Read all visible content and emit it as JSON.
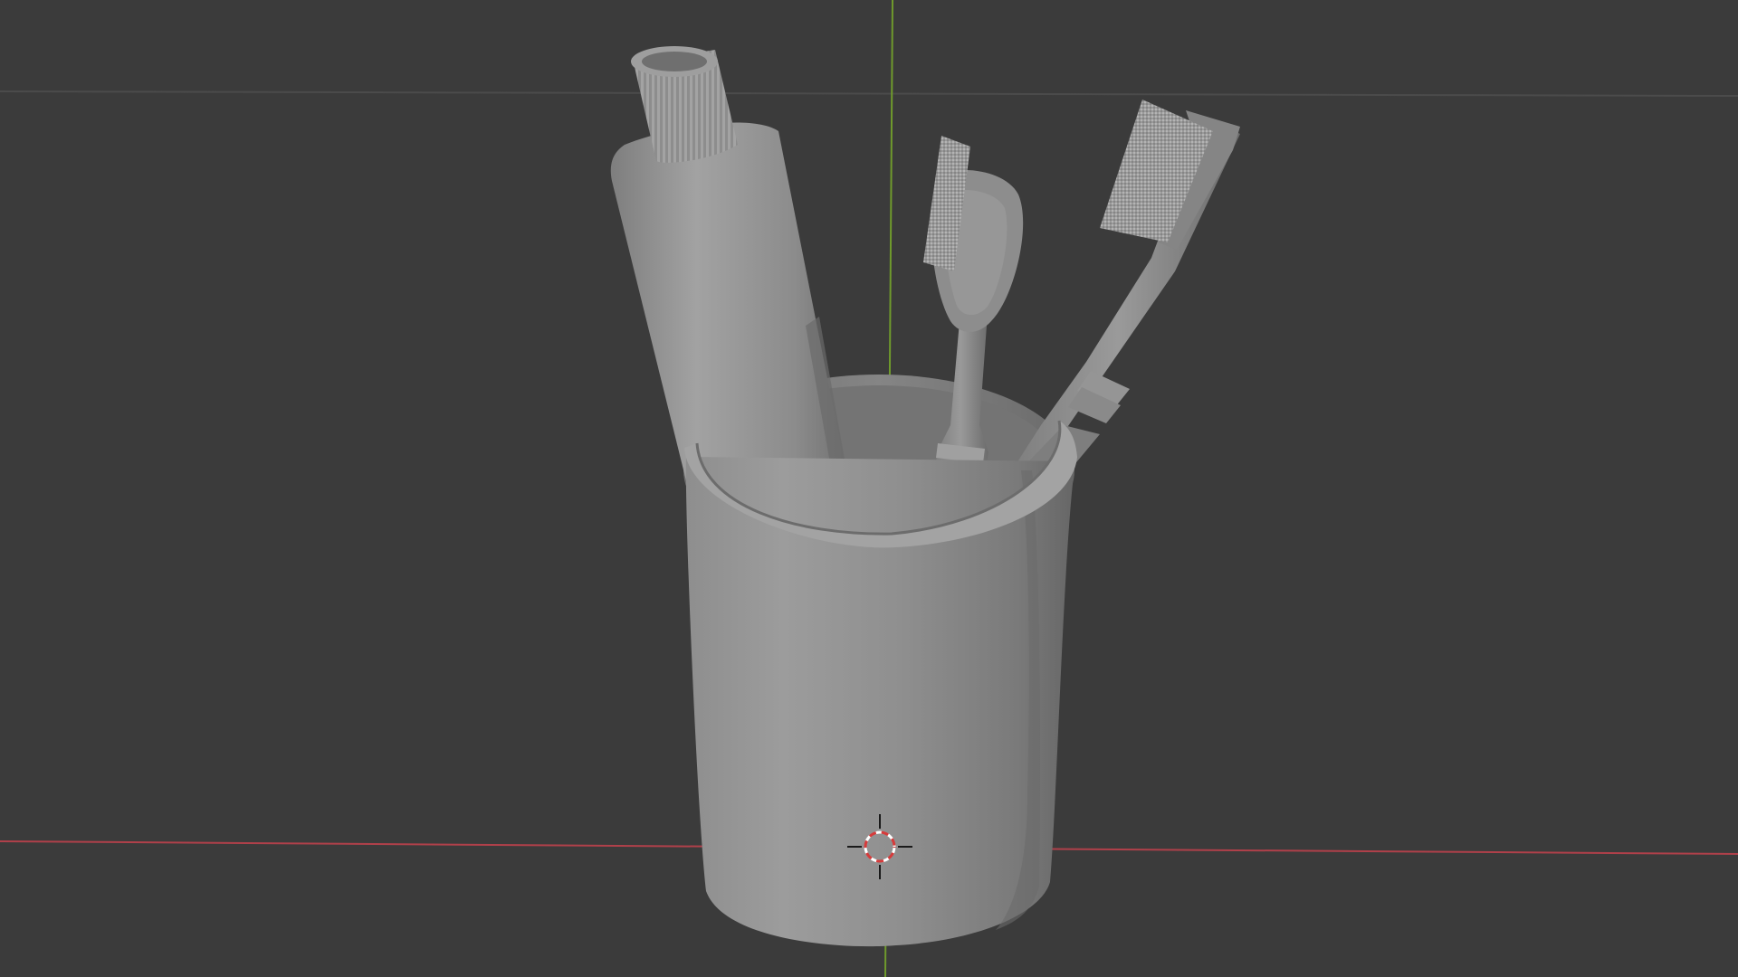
{
  "viewport": {
    "background": "#3b3b3b",
    "grid_color": "#4a4a4a",
    "x_axis_color": "#b0404a",
    "y_axis_color": "#6f9a2c",
    "clay_color": "#8a8a8a",
    "cursor_accent": "#d63b3b"
  },
  "scene": {
    "objects": [
      {
        "name": "cup"
      },
      {
        "name": "toothpaste-tube"
      },
      {
        "name": "toothbrush-left"
      },
      {
        "name": "toothbrush-right"
      }
    ],
    "cursor": "3d-cursor-icon"
  }
}
